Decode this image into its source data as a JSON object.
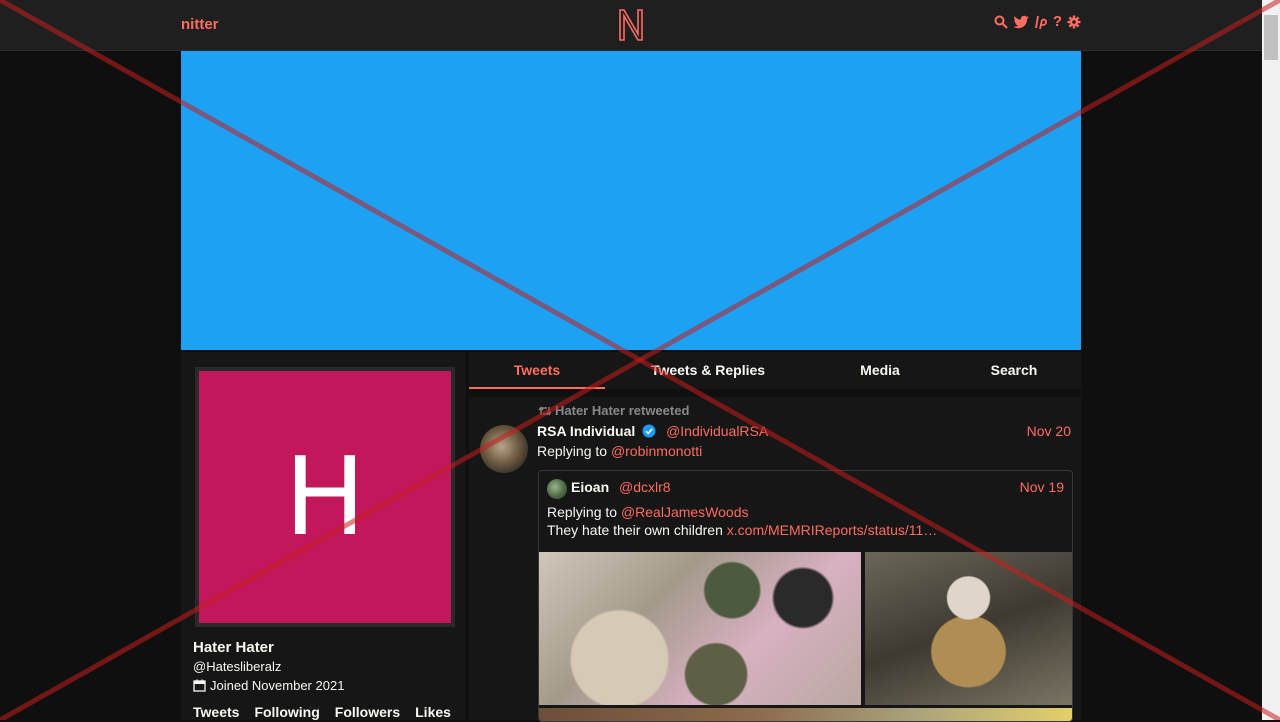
{
  "navbar": {
    "brand": "nitter",
    "logo_letter": "N",
    "icons": [
      "search-icon",
      "twitter-bird-icon",
      "lp-icon",
      "help-icon",
      "settings-icon"
    ],
    "help_glyph": "?"
  },
  "profile": {
    "avatar_letter": "H",
    "fullname": "Hater Hater",
    "username": "@Hatesliberalz",
    "joined": "Joined November 2021",
    "stats": [
      "Tweets",
      "Following",
      "Followers",
      "Likes"
    ]
  },
  "tabs": [
    {
      "label": "Tweets",
      "active": true
    },
    {
      "label": "Tweets & Replies",
      "active": false
    },
    {
      "label": "Media",
      "active": false
    },
    {
      "label": "Search",
      "active": false
    }
  ],
  "tweet": {
    "retweet_header": "Hater Hater retweeted",
    "fullname": "RSA Individual",
    "username": "@IndividualRSA",
    "date": "Nov 20",
    "replying_label": "Replying to",
    "replying_to": "@robinmonotti",
    "quote": {
      "fullname": "Eioan",
      "username": "@dcxlr8",
      "date": "Nov 19",
      "replying_label": "Replying to",
      "replying_to": "@RealJamesWoods",
      "text": "They hate their own children",
      "link": "x.com/MEMRIReports/status/11…"
    }
  },
  "colors": {
    "accent": "#ff6c60",
    "banner": "#1da1f2",
    "avatar_bg": "#c2185b",
    "background": "#0f0f0f",
    "panel": "#161616",
    "navbar": "#1f1f1f",
    "verified": "#1d9bf0"
  }
}
